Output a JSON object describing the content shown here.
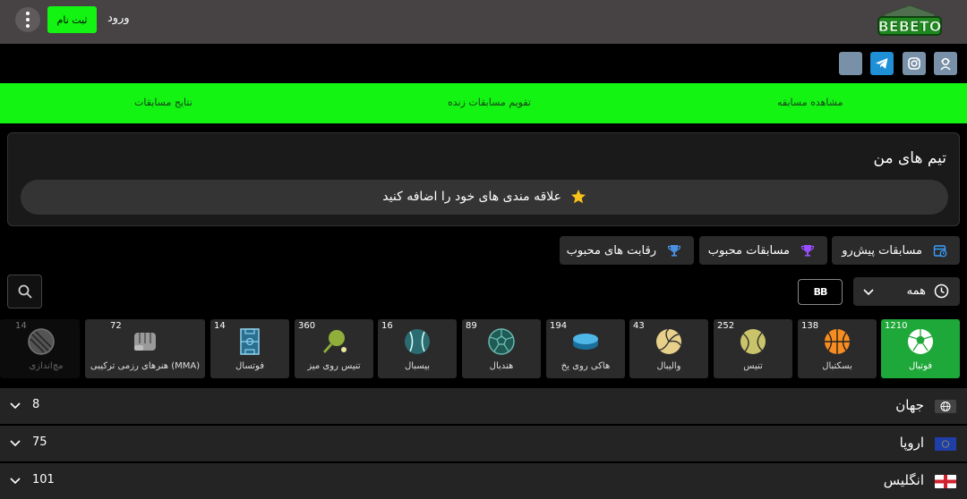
{
  "header": {
    "logo": "BEBETO",
    "register_label": "ثبت نام",
    "login_label": "ورود",
    "menu_icon": "kebab-menu-icon"
  },
  "social": [
    {
      "name": "blank",
      "icon": "blank-icon"
    },
    {
      "name": "telegram",
      "icon": "telegram-icon"
    },
    {
      "name": "instagram",
      "icon": "instagram-icon"
    },
    {
      "name": "support",
      "icon": "support-icon"
    }
  ],
  "nav": {
    "items": [
      "مشاهده مسابقه",
      "تقویم مسابقات زنده",
      "نتایج مسابقات"
    ]
  },
  "my_teams": {
    "title": "تیم های من",
    "add_label": "علاقه مندی های خود را اضافه کنید"
  },
  "tabs": [
    {
      "label": "مسابقات پیش‌رو",
      "icon": "calendar-icon"
    },
    {
      "label": "مسابقات محبوب",
      "icon": "trophy-icon"
    },
    {
      "label": "رقابت های محبوب",
      "icon": "cup-icon"
    }
  ],
  "filter": {
    "selected": "همه",
    "toggle_label": "BB"
  },
  "sports": [
    {
      "name": "فوتبال",
      "count": "1210",
      "active": true
    },
    {
      "name": "بسکتبال",
      "count": "138"
    },
    {
      "name": "تنیس",
      "count": "252"
    },
    {
      "name": "والیبال",
      "count": "43"
    },
    {
      "name": "هاکی روی یخ",
      "count": "194"
    },
    {
      "name": "هندبال",
      "count": "89"
    },
    {
      "name": "بیسبال",
      "count": "16"
    },
    {
      "name": "تنیس روی میز",
      "count": "360"
    },
    {
      "name": "فوتسال",
      "count": "14"
    },
    {
      "name": "هنرهای رزمی ترکیبی (MMA)",
      "count": "72"
    },
    {
      "name": "مچ‌اندازی",
      "count": "14"
    }
  ],
  "regions": [
    {
      "name": "جهان",
      "count": "8",
      "flag": "globe-icon"
    },
    {
      "name": "اروپا",
      "count": "75",
      "flag": "eu-flag-icon"
    },
    {
      "name": "انگلیس",
      "count": "101",
      "flag": "england-flag-icon"
    }
  ],
  "colors": {
    "accent": "#13f413",
    "active_sport": "#1fa83a",
    "header": "#474344",
    "panel": "#2b2b2b"
  }
}
